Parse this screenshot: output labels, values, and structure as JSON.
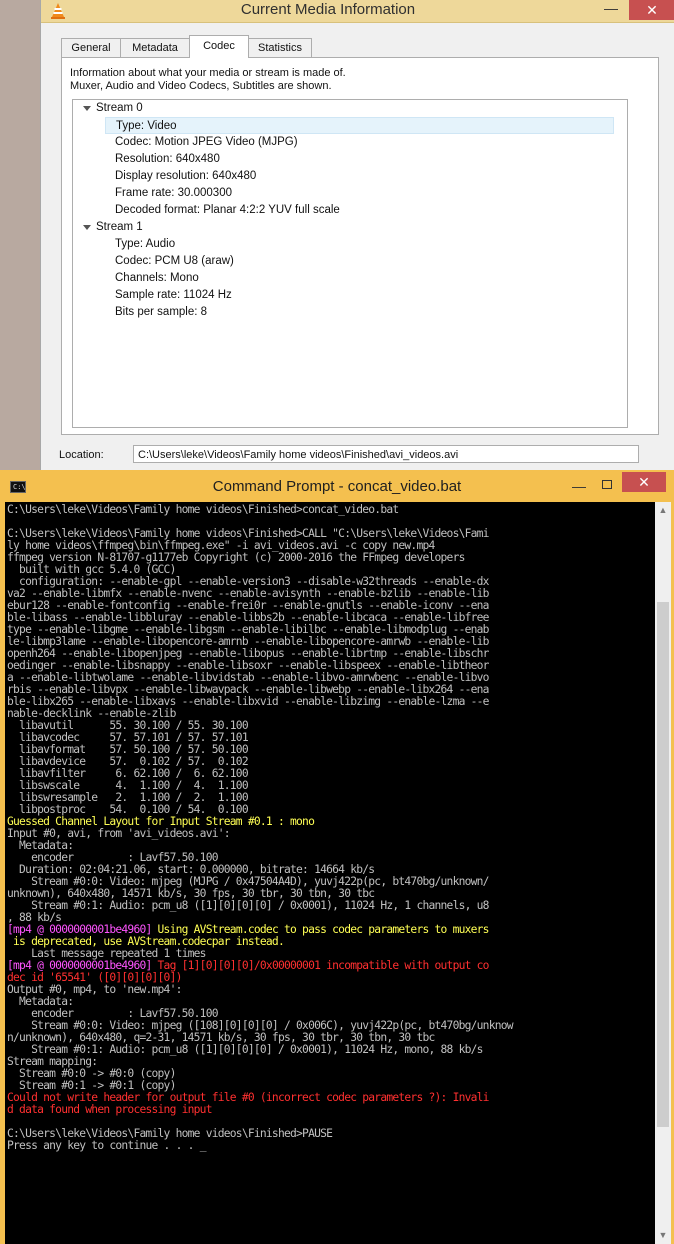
{
  "media_info": {
    "title": "Current Media Information",
    "tabs": [
      {
        "label": "General"
      },
      {
        "label": "Metadata"
      },
      {
        "label": "Codec"
      },
      {
        "label": "Statistics"
      }
    ],
    "active_tab": "Codec",
    "description_line1": "Information about what your media or stream is made of.",
    "description_line2": "Muxer, Audio and Video Codecs, Subtitles are shown.",
    "streams": [
      {
        "name": "Stream 0",
        "props": [
          "Type: Video",
          "Codec: Motion JPEG Video (MJPG)",
          "Resolution: 640x480",
          "Display resolution: 640x480",
          "Frame rate: 30.000300",
          "Decoded format: Planar 4:2:2 YUV full scale"
        ]
      },
      {
        "name": "Stream 1",
        "props": [
          "Type: Audio",
          "Codec: PCM U8 (araw)",
          "Channels: Mono",
          "Sample rate: 11024 Hz",
          "Bits per sample: 8"
        ]
      }
    ],
    "location_label": "Location:",
    "location_value": "C:\\Users\\leke\\Videos\\Family home videos\\Finished\\avi_videos.avi",
    "colors": {
      "titlebar": "#eed89a",
      "close": "#c75050"
    }
  },
  "cmd": {
    "title": "Command Prompt - concat_video.bat",
    "icon_text": "C:\\",
    "lines": [
      {
        "t": "C:\\Users\\leke\\Videos\\Family home videos\\Finished>concat_video.bat",
        "c": "white"
      },
      {
        "t": "",
        "c": "white"
      },
      {
        "t": "C:\\Users\\leke\\Videos\\Family home videos\\Finished>CALL \"C:\\Users\\leke\\Videos\\Fami",
        "c": "white"
      },
      {
        "t": "ly home videos\\ffmpeg\\bin\\ffmpeg.exe\" -i avi_videos.avi -c copy new.mp4",
        "c": "white"
      },
      {
        "t": "ffmpeg version N-81707-g1177eb Copyright (c) 2000-2016 the FFmpeg developers",
        "c": "white"
      },
      {
        "t": "  built with gcc 5.4.0 (GCC)",
        "c": "white"
      },
      {
        "t": "  configuration: --enable-gpl --enable-version3 --disable-w32threads --enable-dx",
        "c": "white"
      },
      {
        "t": "va2 --enable-libmfx --enable-nvenc --enable-avisynth --enable-bzlib --enable-lib",
        "c": "white"
      },
      {
        "t": "ebur128 --enable-fontconfig --enable-frei0r --enable-gnutls --enable-iconv --ena",
        "c": "white"
      },
      {
        "t": "ble-libass --enable-libbluray --enable-libbs2b --enable-libcaca --enable-libfree",
        "c": "white"
      },
      {
        "t": "type --enable-libgme --enable-libgsm --enable-libilbc --enable-libmodplug --enab",
        "c": "white"
      },
      {
        "t": "le-libmp3lame --enable-libopencore-amrnb --enable-libopencore-amrwb --enable-lib",
        "c": "white"
      },
      {
        "t": "openh264 --enable-libopenjpeg --enable-libopus --enable-librtmp --enable-libschr",
        "c": "white"
      },
      {
        "t": "oedinger --enable-libsnappy --enable-libsoxr --enable-libspeex --enable-libtheor",
        "c": "white"
      },
      {
        "t": "a --enable-libtwolame --enable-libvidstab --enable-libvo-amrwbenc --enable-libvo",
        "c": "white"
      },
      {
        "t": "rbis --enable-libvpx --enable-libwavpack --enable-libwebp --enable-libx264 --ena",
        "c": "white"
      },
      {
        "t": "ble-libx265 --enable-libxavs --enable-libxvid --enable-libzimg --enable-lzma --e",
        "c": "white"
      },
      {
        "t": "nable-decklink --enable-zlib",
        "c": "white"
      },
      {
        "t": "  libavutil      55. 30.100 / 55. 30.100",
        "c": "white"
      },
      {
        "t": "  libavcodec     57. 57.101 / 57. 57.101",
        "c": "white"
      },
      {
        "t": "  libavformat    57. 50.100 / 57. 50.100",
        "c": "white"
      },
      {
        "t": "  libavdevice    57.  0.102 / 57.  0.102",
        "c": "white"
      },
      {
        "t": "  libavfilter     6. 62.100 /  6. 62.100",
        "c": "white"
      },
      {
        "t": "  libswscale      4.  1.100 /  4.  1.100",
        "c": "white"
      },
      {
        "t": "  libswresample   2.  1.100 /  2.  1.100",
        "c": "white"
      },
      {
        "t": "  libpostproc    54.  0.100 / 54.  0.100",
        "c": "white"
      },
      {
        "t": "Guessed Channel Layout for Input Stream #0.1 : mono",
        "c": "yellow"
      },
      {
        "t": "Input #0, avi, from 'avi_videos.avi':",
        "c": "white"
      },
      {
        "t": "  Metadata:",
        "c": "white"
      },
      {
        "t": "    encoder         : Lavf57.50.100",
        "c": "white"
      },
      {
        "t": "  Duration: 02:04:21.06, start: 0.000000, bitrate: 14664 kb/s",
        "c": "white"
      },
      {
        "t": "    Stream #0:0: Video: mjpeg (MJPG / 0x47504A4D), yuvj422p(pc, bt470bg/unknown/",
        "c": "white"
      },
      {
        "t": "unknown), 640x480, 14571 kb/s, 30 fps, 30 tbr, 30 tbn, 30 tbc",
        "c": "white"
      },
      {
        "t": "    Stream #0:1: Audio: pcm_u8 ([1][0][0][0] / 0x0001), 11024 Hz, 1 channels, u8",
        "c": "white"
      },
      {
        "t": ", 88 kb/s",
        "c": "white"
      },
      {
        "t": "[mp4 @ 0000000001be4960] Using AVStream.codec to pass codec parameters to muxers",
        "c": "yellow",
        "p": "[mp4 @ 0000000001be4960]"
      },
      {
        "t": " is deprecated, use AVStream.codecpar instead.",
        "c": "yellow"
      },
      {
        "t": "    Last message repeated 1 times",
        "c": "white"
      },
      {
        "t": "[mp4 @ 0000000001be4960] Tag [1][0][0][0]/0x00000001 incompatible with output co",
        "c": "red",
        "p": "[mp4 @ 0000000001be4960]"
      },
      {
        "t": "dec id '65541' ([0][0][0][0])",
        "c": "red"
      },
      {
        "t": "Output #0, mp4, to 'new.mp4':",
        "c": "white"
      },
      {
        "t": "  Metadata:",
        "c": "white"
      },
      {
        "t": "    encoder         : Lavf57.50.100",
        "c": "white"
      },
      {
        "t": "    Stream #0:0: Video: mjpeg ([108][0][0][0] / 0x006C), yuvj422p(pc, bt470bg/unknow",
        "c": "white"
      },
      {
        "t": "n/unknown), 640x480, q=2-31, 14571 kb/s, 30 fps, 30 tbr, 30 tbn, 30 tbc",
        "c": "white"
      },
      {
        "t": "    Stream #0:1: Audio: pcm_u8 ([1][0][0][0] / 0x0001), 11024 Hz, mono, 88 kb/s",
        "c": "white"
      },
      {
        "t": "Stream mapping:",
        "c": "white"
      },
      {
        "t": "  Stream #0:0 -> #0:0 (copy)",
        "c": "white"
      },
      {
        "t": "  Stream #0:1 -> #0:1 (copy)",
        "c": "white"
      },
      {
        "t": "Could not write header for output file #0 (incorrect codec parameters ?): Invali",
        "c": "red"
      },
      {
        "t": "d data found when processing input",
        "c": "red"
      },
      {
        "t": "",
        "c": "white"
      },
      {
        "t": "C:\\Users\\leke\\Videos\\Family home videos\\Finished>PAUSE",
        "c": "white"
      },
      {
        "t": "Press any key to continue . . . ",
        "c": "white",
        "cursor": "_"
      }
    ],
    "colors": {
      "white": "#c0c0c0",
      "yellow": "#ffff55",
      "red": "#ff3030",
      "magenta": "#ff55ff",
      "titlebar": "#f4c04f"
    }
  }
}
